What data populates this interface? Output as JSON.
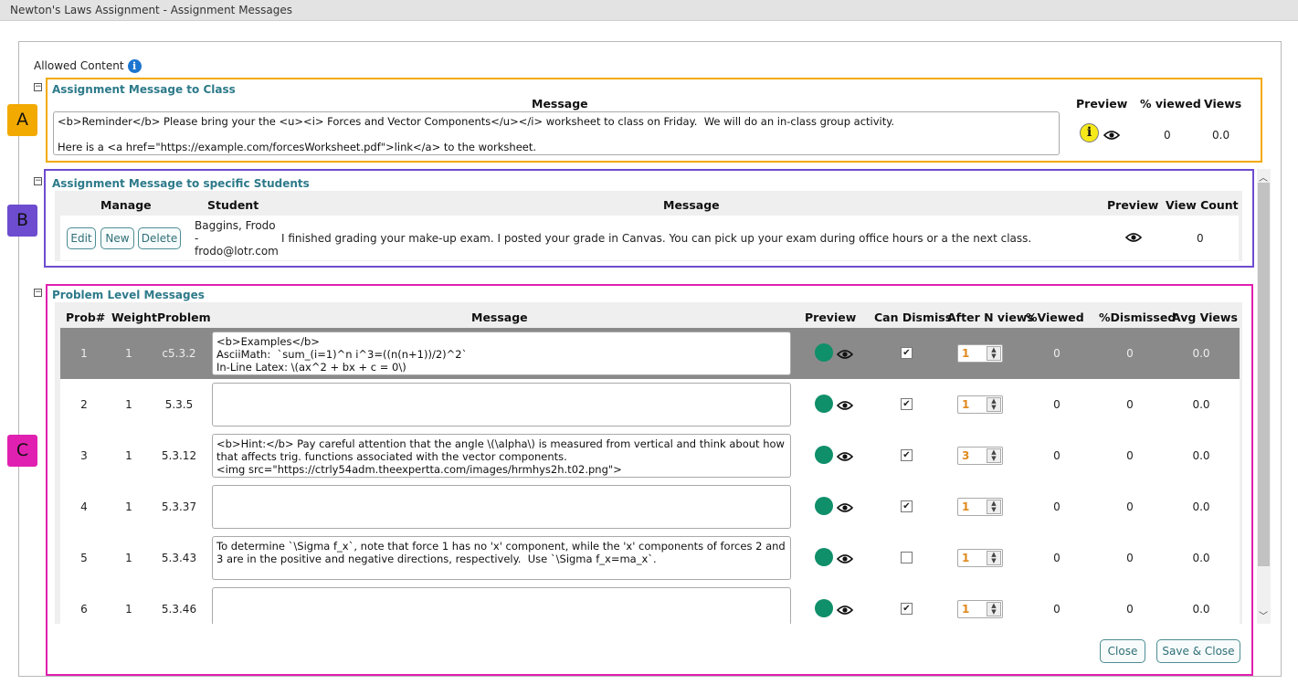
{
  "window_title": "Newton's Laws Assignment - Assignment Messages",
  "allowed_content": "Allowed Content",
  "badges": {
    "a": "A",
    "b": "B",
    "c": "C"
  },
  "colors": {
    "section_a": "#f2a900",
    "section_b": "#6d4ccf",
    "section_c": "#e020b0",
    "title_teal": "#2d7a8a",
    "dot_green": "#0f8f6a"
  },
  "class_message": {
    "title": "Assignment Message to Class",
    "headers": {
      "message": "Message",
      "preview": "Preview",
      "viewed": "% viewed",
      "views": "Views"
    },
    "text": "<b>Reminder</b> Please bring your the <u><i> Forces and Vector Components</u></i> worksheet to class on Friday.  We will do an in-class group activity.\n\nHere is a <a href=\"https://example.com/forcesWorksheet.pdf\">link</a> to the worksheet.",
    "viewed": "0",
    "views": "0.0"
  },
  "student_messages": {
    "title": "Assignment Message to specific Students",
    "headers": {
      "manage": "Manage",
      "student": "Student",
      "message": "Message",
      "preview": "Preview",
      "view_count": "View Count"
    },
    "buttons": {
      "edit": "Edit",
      "new": "New",
      "delete": "Delete"
    },
    "row": {
      "student_name": "Baggins, Frodo",
      "dash": "-",
      "student_email": "frodo@lotr.com",
      "message": "I finished grading your make-up exam. I posted your grade in Canvas. You can pick up your exam during office hours or a the next class.",
      "view_count": "0"
    }
  },
  "problem_messages": {
    "title": "Problem Level Messages",
    "headers": {
      "prob": "Prob#",
      "weight": "Weight",
      "problem": "Problem",
      "message": "Message",
      "preview": "Preview",
      "can_dismiss": "Can Dismiss",
      "after_n": "After N views",
      "viewed": "%Viewed",
      "dismissed": "%Dismissed",
      "avg_views": "Avg Views"
    },
    "rows": [
      {
        "num": "1",
        "weight": "1",
        "problem": "c5.3.2",
        "message": "<b>Examples</b>\nAsciiMath:  `sum_(i=1)^n i^3=((n(n+1))/2)^2`\nIn-Line Latex: \\(ax^2 + bx + c = 0\\)",
        "dismiss": true,
        "after_n": "1",
        "viewed": "0",
        "dismissed": "0",
        "avg": "0.0"
      },
      {
        "num": "2",
        "weight": "1",
        "problem": "5.3.5",
        "message": "",
        "dismiss": true,
        "after_n": "1",
        "viewed": "0",
        "dismissed": "0",
        "avg": "0.0"
      },
      {
        "num": "3",
        "weight": "1",
        "problem": "5.3.12",
        "message": "<b>Hint:</b> Pay careful attention that the angle \\(\\alpha\\) is measured from vertical and think about how that affects trig. functions associated with the vector components.\n<img src=\"https://ctrly54adm.theexpertta.com/images/hrmhys2h.t02.png\">",
        "dismiss": true,
        "after_n": "3",
        "viewed": "0",
        "dismissed": "0",
        "avg": "0.0"
      },
      {
        "num": "4",
        "weight": "1",
        "problem": "5.3.37",
        "message": "",
        "dismiss": true,
        "after_n": "1",
        "viewed": "0",
        "dismissed": "0",
        "avg": "0.0"
      },
      {
        "num": "5",
        "weight": "1",
        "problem": "5.3.43",
        "message": "To determine `\\Sigma f_x`, note that force 1 has no 'x' component, while the 'x' components of forces 2 and 3 are in the positive and negative directions, respectively.  Use `\\Sigma f_x=ma_x`.",
        "dismiss": false,
        "after_n": "1",
        "viewed": "0",
        "dismissed": "0",
        "avg": "0.0"
      },
      {
        "num": "6",
        "weight": "1",
        "problem": "5.3.46",
        "message": "",
        "dismiss": true,
        "after_n": "1",
        "viewed": "0",
        "dismissed": "0",
        "avg": "0.0"
      }
    ]
  },
  "footer": {
    "close": "Close",
    "save_close": "Save & Close"
  }
}
